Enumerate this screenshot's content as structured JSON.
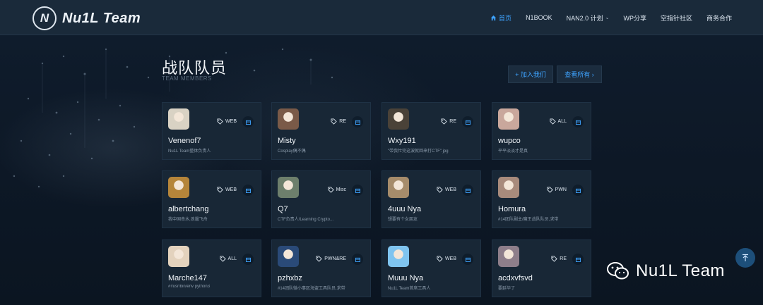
{
  "nav": {
    "brand": "Nu1L Team",
    "logo_letter": "N",
    "items": [
      {
        "label": "首页",
        "active": true
      },
      {
        "label": "N1BOOK"
      },
      {
        "label": "NAN2.0 计划",
        "has_dropdown": true
      },
      {
        "label": "WP分享"
      },
      {
        "label": "空指针社区"
      },
      {
        "label": "商务合作"
      }
    ]
  },
  "heading": {
    "title": "战队队员",
    "subtitle": "TEAM MEMBERS"
  },
  "actions": {
    "join_label": "+ 加入我们",
    "view_all_label": "查看所有 ›"
  },
  "members": [
    {
      "name": "Venenof7",
      "tag": "WEB",
      "desc": "Nu1L Team整体负责人",
      "avatar_color": "#d9d2c4"
    },
    {
      "name": "Misty",
      "tag": "RE",
      "desc": "Cosplay偶不偶",
      "avatar_color": "#7a5a48"
    },
    {
      "name": "Wxy191",
      "tag": "RE",
      "desc": "\"带我忙完这波就回来打CTF\".jpg",
      "avatar_color": "#4a4238"
    },
    {
      "name": "wupco",
      "tag": "ALL",
      "desc": "平平淡淡才是真",
      "avatar_color": "#c9a79c"
    },
    {
      "name": "albertchang",
      "tag": "WEB",
      "desc": "我中国击水,浪遏飞舟",
      "avatar_color": "#b5853a"
    },
    {
      "name": "Q7",
      "tag": "Misc",
      "desc": "CTF负责人/Learning Crypto...",
      "avatar_color": "#6d7f6c"
    },
    {
      "name": "4uuu Nya",
      "tag": "WEB",
      "desc": "想要有个女朋友",
      "avatar_color": "#a68c6b"
    },
    {
      "name": "Homura",
      "tag": "PWN",
      "desc": "#14团队副主/魔王战队队员,求带",
      "avatar_color": "#a88b7c"
    },
    {
      "name": "Marche147",
      "tag": "ALL",
      "desc": "#!/usr/bin/env python3",
      "avatar_color": "#e3d2bd"
    },
    {
      "name": "pzhxbz",
      "tag": "PWN&RE",
      "desc": "#14团队微小事区海盗工具队员,求带",
      "avatar_color": "#2a4a78"
    },
    {
      "name": "Muuu Nya",
      "tag": "WEB",
      "desc": "Nu1L Team首席工具人",
      "avatar_color": "#7fc4ef"
    },
    {
      "name": "acdxvfsvd",
      "tag": "RE",
      "desc": "要延毕了",
      "avatar_color": "#8e7e8a"
    }
  ],
  "watermark": {
    "text": "Nu1L Team"
  },
  "colors": {
    "accent": "#3ea3ff",
    "card_bg": "#182736",
    "page_bg": "#0c1724"
  }
}
